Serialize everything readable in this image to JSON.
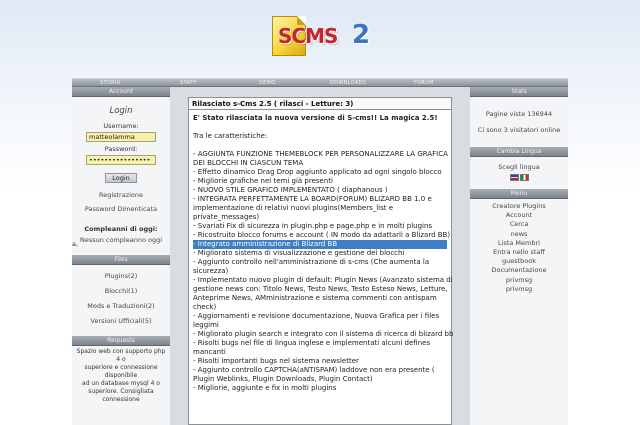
{
  "logo": {
    "text": "SCMS",
    "number": "2"
  },
  "nav": [
    "STORIA",
    "STAFF",
    "DEMO",
    "DOWNLOADS",
    "FORUM"
  ],
  "left": {
    "account": {
      "title": "Account",
      "login_title": "Login",
      "username_label": "Username:",
      "username_value": "matteolamma",
      "password_label": "Password:",
      "password_value": "••••••••••••••••",
      "login_button": "Login",
      "register_link": "Registrazione",
      "forgot_link": "Password Dimenticata",
      "edge_mark": "a,",
      "birthdays_title": "Compleanni di oggi:",
      "birthdays_value": "Nessun compleanno oggi"
    },
    "files": {
      "title": "Files",
      "items": [
        "Plugins(2)",
        "Blocchi(1)",
        "Mods e Traduzioni(2)",
        "Versioni Ufficiali(5)"
      ]
    },
    "requests": {
      "title": "Requests",
      "lines": [
        "Spazio web con supporto php 4 o",
        "superiore e connessione disponibile",
        "ad un database mysql 4 o",
        "superiore. Consigliata connessione"
      ]
    }
  },
  "center": {
    "title": "Rilasciato s-Cms 2.5 ( rilasci - Letture: 3)",
    "lead": "E' Stato rilasciata la nuova versione di S-cms!! La magica 2.5!",
    "intro": "Tra le caratteristiche:",
    "lines": [
      "- AGGIUNTA FUNZIONE THEMEBLOCK PER PERSONALIZZARE LA GRAFICA",
      "DEI BLOCCHI IN CIASCUN TEMA",
      "- Effetto dinamico Drag Drop aggiunto applicato ad ogni singolo blocco",
      "- Migliorie grafiche nei temi già presenti",
      "- NUOVO STILE GRAFICO IMPLEMENTATO ( diaphanous )",
      "- INTEGRATA PERFETTAMENTE LA BOARD(FORUM) BLIZARD BB 1.0 e",
      "implementazione di relativi nuovi plugins(Members_list e",
      "private_messages)",
      "- Svariati Fix di sicurezza in plugin.php e page.php e in molti plugins",
      "- Ricostruito blocco forums e account ( IN modo da adattarli a Blizard BB)",
      "- Integrato amministrazione di Blizard BB",
      "- Migliorato sistema di visualizzazione e gestione dei blocchi",
      "- Aggiunto controllo nell'amministrazione di s-cms (Che aumenta la",
      "sicurezza)",
      "- Implementato nuovo plugin di default: Plugin News (Avanzato sistema di",
      "gestione news con: Titolo News, Testo News, Testo Esteso News, Letture,",
      "Anteprime News, AMministrazione e sistema commenti con antispam",
      "check)",
      "- Aggiornamenti e revisione documentazione, Nuova Grafica per i files",
      "leggimi",
      "- Migliorato plugin search e integrato con il sistema di ricerca di blizard bb",
      "- Risolti bugs nel file di lingua inglese e implementati alcuni defines",
      "mancanti",
      "- Risolti importanti bugs nel sistema newsletter",
      "- Aggiunto controllo CAPTCHA(aNTISPAM) laddove non era presente (",
      "Plugin Weblinks, Plugin Downloads, Plugin Contact)",
      "- Migliorie, aggiunte e fix in molti plugins"
    ],
    "highlight_index": 10
  },
  "right": {
    "stats": {
      "title": "Stats",
      "page_views": "Pagine viste 136944",
      "visitors": "Ci sono 3 visitatori online"
    },
    "language": {
      "title": "Cambia Lingua",
      "label": "Scegli lingua"
    },
    "menu": {
      "title": "Menu",
      "items": [
        "Creatore Plugins",
        "Account",
        "Cerca",
        "news",
        "Lista Membri",
        "Entra nello staff",
        "guestbook",
        "Documentazione",
        "privmsg",
        "privmsg"
      ]
    }
  },
  "colors": {
    "nav_bg": "#8d949b",
    "highlight": "#3f7ec4",
    "field_bg": "#f8f0b0",
    "logo_red": "#c1272d",
    "logo_blue": "#3a75c4"
  }
}
